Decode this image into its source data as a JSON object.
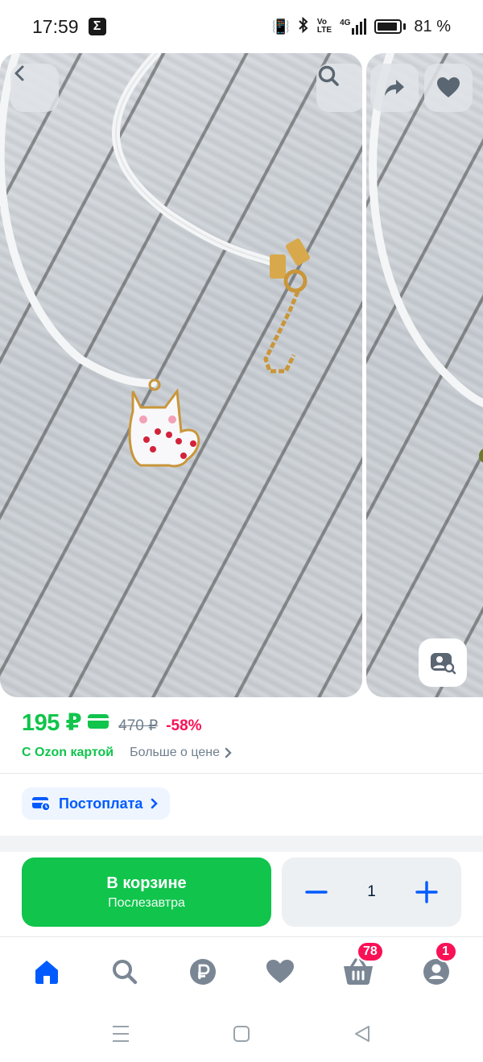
{
  "status_bar": {
    "time": "17:59",
    "notif_icon": "sigma-icon",
    "battery": "81 %",
    "network": "4G"
  },
  "gallery": {
    "images": [
      "main-product-photo",
      "next-product-photo"
    ],
    "buttons": [
      "back-icon",
      "search-icon",
      "share-icon",
      "heart-icon",
      "visual-search-icon"
    ]
  },
  "price": {
    "current": "195 ₽",
    "old": "470 ₽",
    "discount": "-58%",
    "ozon_card_label": "С Ozon картой",
    "more_about_price": "Больше о цене"
  },
  "postpay": {
    "label": "Постоплата"
  },
  "cart": {
    "button_title": "В корзине",
    "button_subtitle": "Послезавтра",
    "quantity": "1"
  },
  "bottom_nav": {
    "items": [
      "home-icon",
      "search-icon",
      "ruble-icon",
      "favorites-icon",
      "cart-icon",
      "profile-icon"
    ],
    "cart_badge": "78",
    "profile_badge": "1"
  },
  "colors": {
    "accent_green": "#10c44c",
    "ozon_blue": "#005bff",
    "discount_pink": "#f91155"
  }
}
